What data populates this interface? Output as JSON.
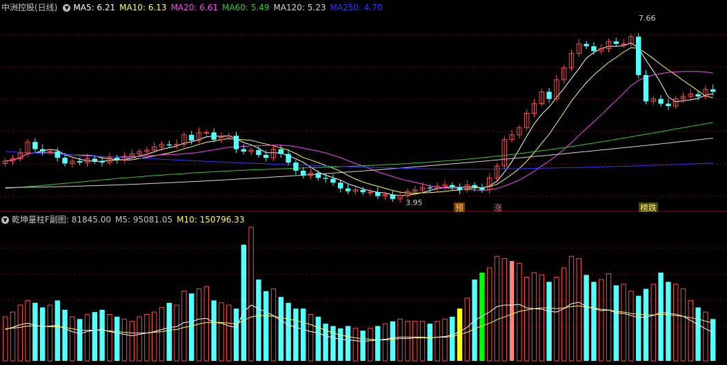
{
  "main_legend": {
    "title": "中洲控股(日线)",
    "ma5_label": "MA5: 6.21",
    "ma10_label": "MA10: 6.13",
    "ma20_label": "MA20: 6.61",
    "ma60_label": "MA60: 5.49",
    "ma120_label": "MA120: 5.23",
    "ma250_label": "MA250: 4.70"
  },
  "sub_legend": {
    "title": "乾坤量柱F副图",
    "value_label": ": 81845.00",
    "m5_label": "M5: 95081.05",
    "m10_label": "M10: 150796.33"
  },
  "colors": {
    "background": "#000000",
    "up": "#ff4a4a",
    "down": "#54ffff",
    "ma5": "#ffffff",
    "ma10": "#ffff55",
    "ma20": "#ff44ff",
    "ma60": "#33cc33",
    "ma120": "#d8d8d8",
    "ma250": "#3333ff",
    "grid": "#8b0000",
    "vol_yellow": "#ffff00",
    "vol_green": "#00ff00",
    "vol_pink": "#ff8080"
  },
  "annotations": {
    "high_label": "7.66",
    "low_label": "3.95",
    "marker_yu": "预",
    "marker_zhang": "涨",
    "marker_bangdie": "榜跌"
  },
  "chart_data": [
    {
      "type": "candlestick",
      "title": "中洲控股(日线)",
      "ylim": [
        3.8,
        7.8
      ],
      "series": [
        {
          "name": "MA5",
          "value": 6.21
        },
        {
          "name": "MA10",
          "value": 6.13
        },
        {
          "name": "MA20",
          "value": 6.61
        },
        {
          "name": "MA60",
          "value": 5.49
        },
        {
          "name": "MA120",
          "value": 5.23
        },
        {
          "name": "MA250",
          "value": 4.7
        }
      ],
      "max_price": 7.66,
      "min_price": 3.95,
      "closes": [
        4.75,
        4.8,
        4.92,
        5.15,
        5.0,
        4.95,
        4.95,
        4.82,
        4.7,
        4.75,
        4.72,
        4.8,
        4.75,
        4.72,
        4.82,
        4.78,
        4.85,
        4.9,
        4.95,
        4.98,
        5.05,
        5.1,
        5.08,
        5.1,
        5.3,
        5.18,
        5.35,
        5.35,
        5.2,
        5.25,
        5.28,
        5.0,
        4.95,
        4.98,
        4.88,
        4.82,
        5.0,
        4.9,
        4.72,
        4.55,
        4.45,
        4.5,
        4.4,
        4.38,
        4.3,
        4.18,
        4.12,
        4.15,
        4.1,
        4.1,
        4.02,
        4.05,
        3.96,
        4.03,
        4.12,
        4.15,
        4.2,
        4.18,
        4.22,
        4.25,
        4.2,
        4.15,
        4.25,
        4.2,
        4.15,
        4.4,
        4.65,
        5.2,
        5.3,
        5.45,
        5.75,
        5.95,
        6.2,
        6.05,
        6.45,
        6.7,
        7.0,
        7.2,
        7.15,
        7.05,
        7.1,
        7.25,
        7.2,
        7.2,
        7.35,
        6.55,
        6.0,
        6.05,
        5.95,
        5.9,
        6.05,
        6.1,
        6.15,
        6.1,
        6.25,
        6.2
      ],
      "volumes": [
        38,
        42,
        48,
        52,
        50,
        46,
        48,
        52,
        44,
        38,
        36,
        40,
        42,
        44,
        40,
        38,
        36,
        34,
        38,
        40,
        42,
        46,
        50,
        48,
        60,
        58,
        62,
        64,
        52,
        50,
        48,
        45,
        100,
        115,
        70,
        60,
        62,
        55,
        50,
        45,
        45,
        40,
        38,
        32,
        30,
        28,
        30,
        28,
        26,
        28,
        30,
        32,
        34,
        36,
        34,
        34,
        34,
        32,
        34,
        36,
        38,
        45,
        54,
        70,
        76,
        80,
        90,
        88,
        86,
        84,
        72,
        76,
        74,
        68,
        72,
        80,
        90,
        88,
        74,
        68,
        70,
        75,
        65,
        66,
        60,
        56,
        62,
        66,
        76,
        68,
        66,
        62,
        52,
        46,
        42,
        36
      ],
      "vol_m5": [
        45000.0,
        48000.0,
        52000.0,
        54000.0,
        51000.0,
        49000.0,
        50000.0,
        51000.0,
        46000.0,
        42000.0,
        39000.0,
        42000.0,
        44000.0,
        45000.0,
        42000.0,
        40000.0,
        38000.0,
        36000.0,
        38000.0,
        40000.0,
        42000.0,
        45000.0,
        48000.0,
        49000.0,
        55000.0,
        56000.0,
        60000.0,
        61000.0,
        55000.0,
        54000.0,
        50000.0,
        48000.0,
        70000.0,
        80000.0,
        75000.0,
        70000.0,
        65000.0,
        58000.0,
        52000.0,
        48000.0,
        45000.0,
        42000.0,
        40000.0,
        36000.0,
        33000.0,
        31000.0,
        30000.0,
        29000.0,
        28000.0,
        29000.0,
        30000.0,
        31000.0,
        33000.0,
        34000.0,
        34000.0,
        34000.0,
        34000.0,
        33000.0,
        34000.0,
        35000.0,
        37000.0,
        42000.0,
        48000.0,
        58000.0,
        64000.0,
        70000.0,
        78000.0,
        80000.0,
        80000.0,
        81000.0,
        76000.0,
        75000.0,
        74000.0,
        71000.0,
        70000.0,
        75000.0,
        82000.0,
        84000.0,
        78000.0,
        75000.0,
        72000.0,
        73000.0,
        69000.0,
        68000.0,
        65000.0,
        62000.0,
        63000.0,
        65000.0,
        70000.0,
        68000.0,
        67000.0,
        64000.0,
        58000.0,
        52000.0,
        46000.0,
        41000.0
      ],
      "vol_m10": [
        46000.0,
        47000.0,
        48000.0,
        50000.0,
        50000.0,
        50000.0,
        49000.0,
        49000.0,
        48000.0,
        46000.0,
        44000.0,
        44000.0,
        44000.0,
        44000.0,
        43000.0,
        42000.0,
        41000.0,
        40000.0,
        40000.0,
        40000.0,
        41000.0,
        42000.0,
        44000.0,
        45000.0,
        48000.0,
        50000.0,
        53000.0,
        55000.0,
        55000.0,
        55000.0,
        54000.0,
        53000.0,
        58000.0,
        63000.0,
        65000.0,
        65000.0,
        64000.0,
        62000.0,
        60000.0,
        58000.0,
        55000.0,
        52000.0,
        48000.0,
        44000.0,
        40000.0,
        37000.0,
        35000.0,
        33000.0,
        32000.0,
        31000.0,
        30000.0,
        30000.0,
        31000.0,
        32000.0,
        32000.0,
        33000.0,
        33000.0,
        33000.0,
        34000.0,
        34000.0,
        35000.0,
        38000.0,
        41000.0,
        46000.0,
        50000.0,
        54000.0,
        59000.0,
        63000.0,
        67000.0,
        71000.0,
        73000.0,
        75000.0,
        76000.0,
        76000.0,
        75000.0,
        76000.0,
        78000.0,
        79000.0,
        77000.0,
        76000.0,
        74000.0,
        73000.0,
        71000.0,
        70000.0,
        68000.0,
        67000.0,
        66000.0,
        66000.0,
        67000.0,
        66000.0,
        65000.0,
        64000.0,
        62000.0,
        60000.0,
        57000.0,
        54000.0
      ]
    },
    {
      "type": "bar",
      "title": "乾坤量柱F副图",
      "series": [
        {
          "name": "",
          "value": 81845.0
        },
        {
          "name": "M5",
          "value": 95081.05
        },
        {
          "name": "M10",
          "value": 150796.33
        }
      ]
    }
  ]
}
